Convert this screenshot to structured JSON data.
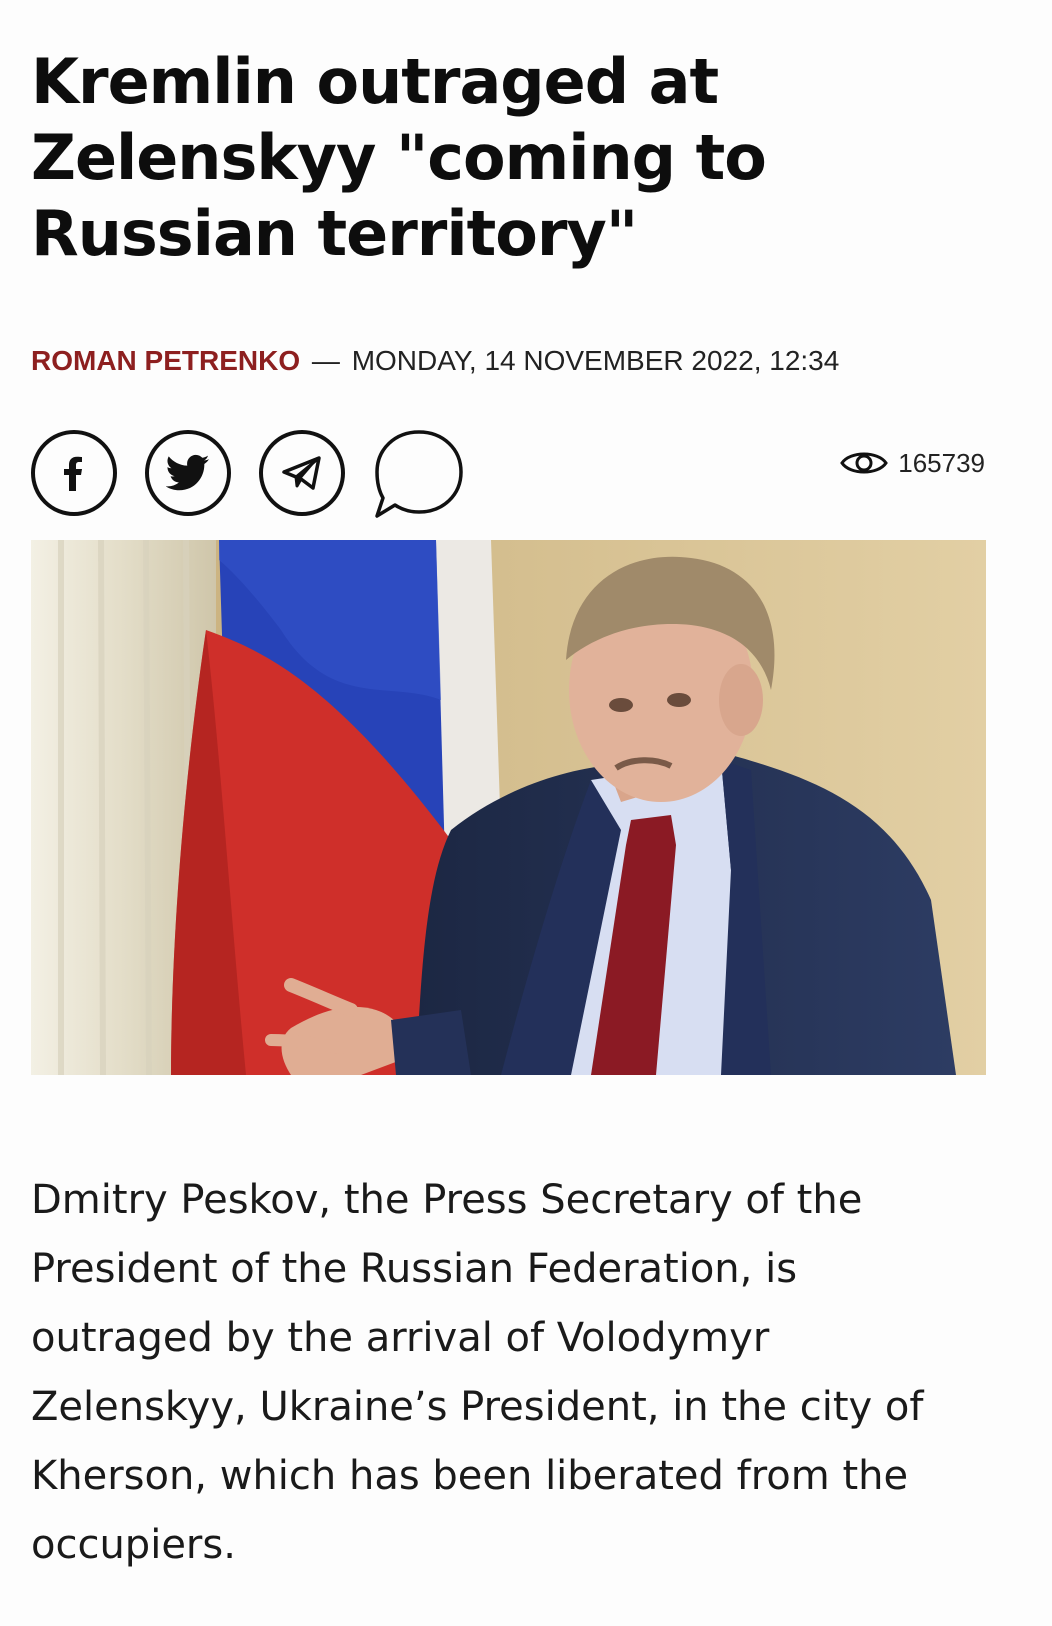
{
  "article": {
    "headline": "Kremlin outraged at Zelenskyy \"coming to Russian territory\"",
    "author": "ROMAN PETRENKO",
    "separator": "—",
    "date": "MONDAY, 14 NOVEMBER 2022, 12:34",
    "views": "165739",
    "body": "Dmitry Peskov, the Press Secretary of the President of the Russian Federation, is outraged by the arrival of Volodymyr Zelenskyy, Ukraine’s President, in the city of Kherson, which has been liberated from the occupiers."
  },
  "share": {
    "buttons": [
      {
        "icon": "facebook-icon"
      },
      {
        "icon": "twitter-icon"
      },
      {
        "icon": "telegram-icon"
      },
      {
        "icon": "comment-icon"
      }
    ],
    "views_icon": "eye-icon"
  },
  "colors": {
    "author": "#8d1f1f",
    "text": "#111111",
    "background": "#fdfdfd"
  }
}
